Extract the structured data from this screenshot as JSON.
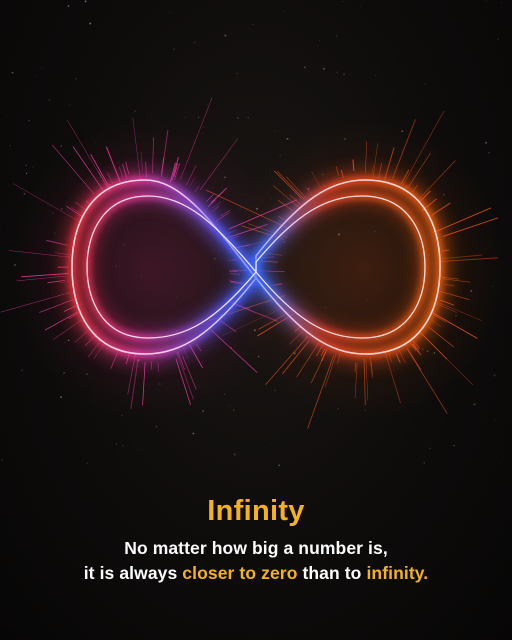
{
  "colors": {
    "accent": "#f5b21f",
    "text": "#ffffff",
    "background": "#0b0a09",
    "loop_pink": "#ff3fa8",
    "loop_blue": "#3b6cff",
    "loop_orange": "#ff5a1a"
  },
  "artwork": {
    "icon": "infinity-icon"
  },
  "caption": {
    "title": "Infinity",
    "line1": "No matter how big a number is,",
    "line2_start": "it is always ",
    "line2_highlight1": "closer to zero",
    "line2_mid": " than to ",
    "line2_highlight2": "infinity."
  }
}
